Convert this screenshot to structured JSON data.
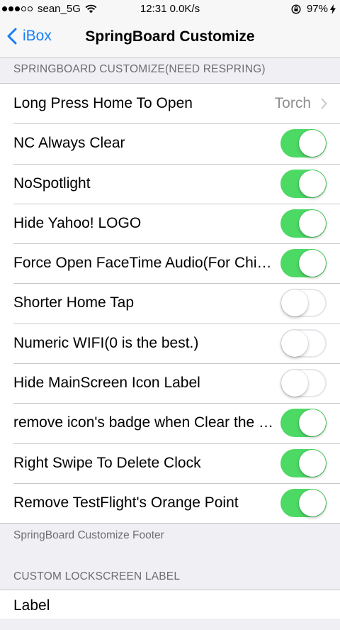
{
  "status_bar": {
    "carrier": "sean_5G",
    "time_speed": "12:31 0.0K/s",
    "battery": "97%"
  },
  "nav": {
    "back_label": "iBox",
    "title": "SpringBoard Customize"
  },
  "section1": {
    "header": "SPRINGBOARD CUSTOMIZE(NEED RESPRING)",
    "footer": "SpringBoard Customize Footer",
    "rows": [
      {
        "label": "Long Press Home To Open",
        "detail": "Torch"
      },
      {
        "label": "NC Always Clear",
        "on": true
      },
      {
        "label": "NoSpotlight",
        "on": true
      },
      {
        "label": "Hide Yahoo! LOGO",
        "on": true
      },
      {
        "label": "Force Open FaceTime Audio(For China)",
        "on": true
      },
      {
        "label": "Shorter Home Tap",
        "on": false
      },
      {
        "label": "Numeric WIFI(0 is the best.)",
        "on": false
      },
      {
        "label": "Hide MainScreen Icon Label",
        "on": false
      },
      {
        "label": "remove icon's badge when Clear the notifications",
        "on": true
      },
      {
        "label": "Right Swipe To Delete Clock",
        "on": true
      },
      {
        "label": "Remove TestFlight's Orange Point",
        "on": true
      }
    ]
  },
  "section2": {
    "header": "CUSTOM LOCKSCREEN LABEL",
    "rows": [
      {
        "label": "Label"
      }
    ]
  },
  "colors": {
    "accent": "#147efb",
    "switch_on": "#4cd964",
    "background": "#efeff4"
  }
}
